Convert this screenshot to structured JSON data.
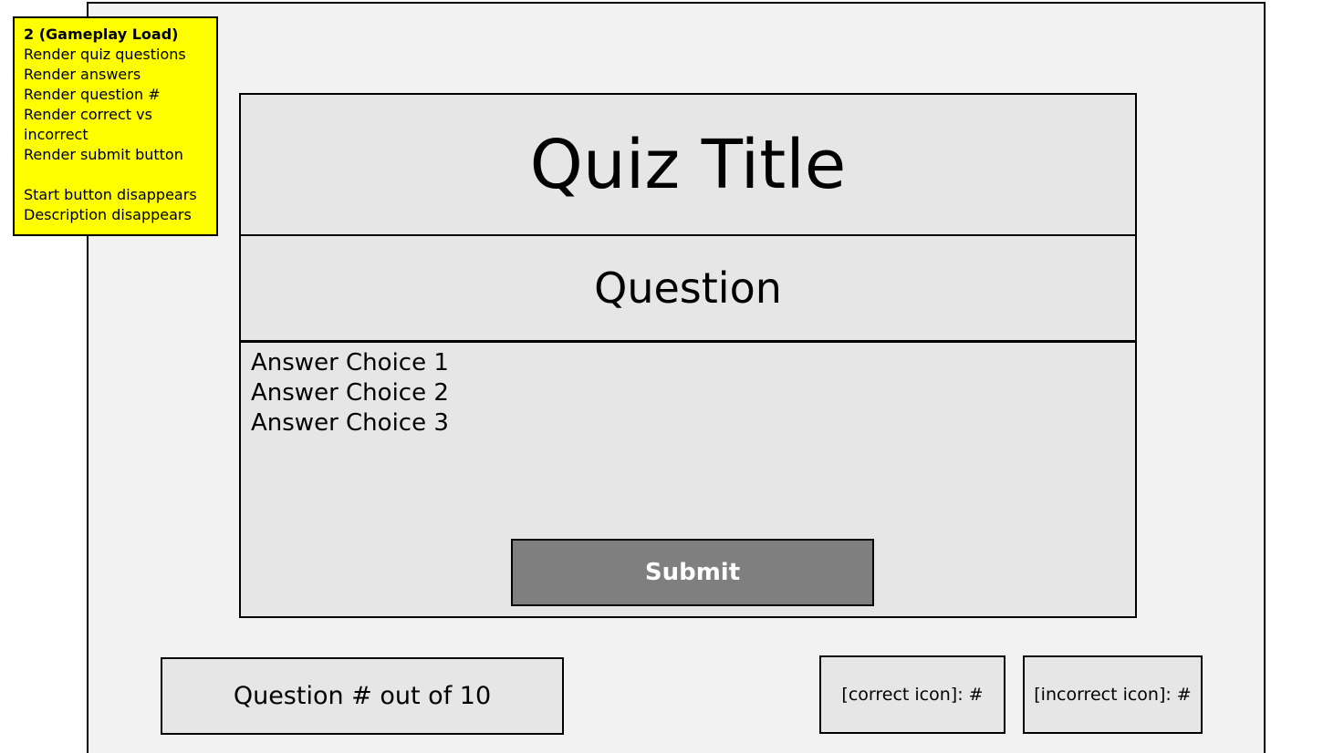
{
  "note": {
    "title": "2 (Gameplay Load)",
    "lines": [
      "Render quiz questions",
      "Render answers",
      "Render question #",
      "Render correct vs incorrect",
      "Render submit button"
    ],
    "lines2": [
      "Start button disappears",
      "Description disappears"
    ],
    "background": "#ffff00"
  },
  "quiz": {
    "title": "Quiz Title",
    "question": "Question",
    "answers": [
      "Answer Choice 1",
      "Answer Choice 2",
      "Answer Choice 3"
    ],
    "submit_label": "Submit"
  },
  "footer": {
    "counter": "Question # out of 10",
    "correct": "[correct icon]: #",
    "incorrect": "[incorrect icon]: #"
  },
  "colors": {
    "frame_bg": "#f2f2f2",
    "box_bg": "#e6e6e6",
    "submit_bg": "#7f7f7f"
  }
}
